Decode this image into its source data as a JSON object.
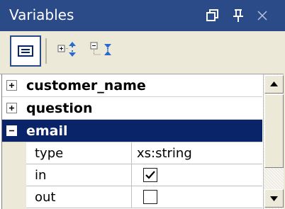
{
  "panel": {
    "title": "Variables",
    "colors": {
      "titlebar": "#2a4a88",
      "selection": "#0a246a",
      "toolbar": "#ece9d8"
    }
  },
  "titlebar_buttons": [
    {
      "name": "restore-icon"
    },
    {
      "name": "pin-icon"
    },
    {
      "name": "close-icon"
    }
  ],
  "toolbar": {
    "buttons": [
      {
        "name": "list-view-icon",
        "pressed": true
      },
      {
        "name": "expand-all-icon",
        "pressed": false
      },
      {
        "name": "collapse-all-icon",
        "pressed": false
      }
    ]
  },
  "variables": [
    {
      "name": "customer_name",
      "expanded": false,
      "selected": false,
      "expander": "+"
    },
    {
      "name": "question",
      "expanded": false,
      "selected": false,
      "expander": "+"
    },
    {
      "name": "email",
      "expanded": true,
      "selected": true,
      "expander": "−"
    }
  ],
  "properties": [
    {
      "label": "type",
      "value": "xs:string",
      "kind": "text"
    },
    {
      "label": "in",
      "value": "",
      "kind": "checkbox",
      "checked": true
    },
    {
      "label": "out",
      "value": "",
      "kind": "checkbox",
      "checked": false
    }
  ]
}
